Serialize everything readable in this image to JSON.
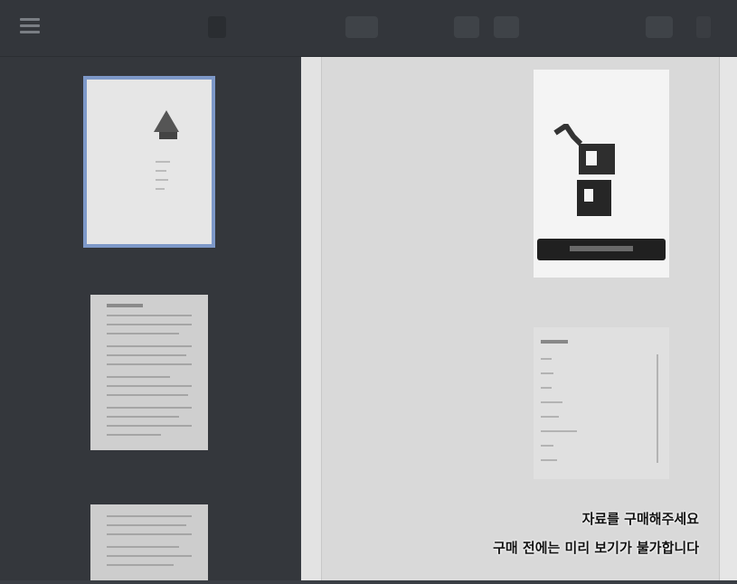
{
  "toolbar": {
    "title": "",
    "menu_icon": "menu-icon",
    "buttons": [
      "",
      "",
      "",
      "",
      "",
      "",
      "",
      ""
    ]
  },
  "sidebar": {
    "thumbnails": [
      {
        "page": "",
        "selected": true
      },
      {
        "page": "",
        "selected": false
      },
      {
        "page": "",
        "selected": false
      }
    ]
  },
  "notice": {
    "line1": "자료를 구매해주세요",
    "line2": "구매 전에는 미리 보기가 불가합니다"
  },
  "colors": {
    "toolbar_bg": "#33363b",
    "sidebar_bg": "#34373c",
    "viewer_bg": "#d9d9d9",
    "selection": "#7d98c8"
  }
}
